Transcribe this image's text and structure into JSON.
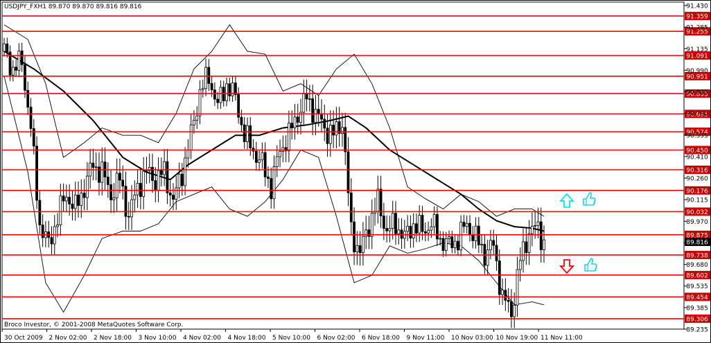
{
  "chart_data": {
    "type": "candlestick",
    "title": "USDJPY_FXH1 89.870 89.870 89.816 89.816",
    "watermark": "Broco Investor, © 2001-2008 MetaQuotes Software Corp.",
    "current_price": "89.816",
    "y_range": [
      89.235,
      91.43
    ],
    "y_ticks": [
      "91.430",
      "91.285",
      "91.135",
      "90.990",
      "90.845",
      "90.700",
      "90.555",
      "90.410",
      "90.260",
      "90.115",
      "89.970",
      "89.825",
      "89.680",
      "89.535",
      "89.385",
      "89.235"
    ],
    "x_ticks": [
      "30 Oct 2009",
      "2 Nov 02:00",
      "2 Nov 18:00",
      "3 Nov 10:00",
      "4 Nov 02:00",
      "4 Nov 18:00",
      "5 Nov 10:00",
      "6 Nov 02:00",
      "6 Nov 18:00",
      "9 Nov 11:00",
      "10 Nov 03:00",
      "10 Nov 19:00",
      "11 Nov 11:00"
    ],
    "levels": [
      "91.359",
      "91.255",
      "91.091",
      "90.951",
      "90.833",
      "90.695",
      "90.574",
      "90.450",
      "90.316",
      "90.176",
      "90.032",
      "89.875",
      "89.738",
      "89.602",
      "89.454",
      "89.306"
    ],
    "grid": false,
    "colors": {
      "level": "#ff0000",
      "level_label_bg": "#cc0000",
      "candle": "#000000",
      "current_bg": "#000000",
      "arrow_up": "#00e5ff",
      "arrow_down": "#ff0000",
      "icon": "#00c8e0"
    },
    "icons": [
      "arrow-up-icon",
      "thumbs-up-icon",
      "arrow-down-icon",
      "thumbs-up-icon"
    ],
    "close_path": [
      [
        0,
        91.12
      ],
      [
        3,
        91.0
      ],
      [
        6,
        91.05
      ],
      [
        9,
        90.6
      ],
      [
        12,
        89.95
      ],
      [
        15,
        89.8
      ],
      [
        18,
        90.0
      ],
      [
        21,
        90.15
      ],
      [
        24,
        90.05
      ],
      [
        27,
        90.2
      ],
      [
        30,
        90.35
      ],
      [
        33,
        90.3
      ],
      [
        36,
        90.15
      ],
      [
        39,
        90.25
      ],
      [
        42,
        90.0
      ],
      [
        45,
        90.2
      ],
      [
        48,
        90.3
      ],
      [
        51,
        90.25
      ],
      [
        54,
        90.3
      ],
      [
        57,
        90.1
      ],
      [
        60,
        90.3
      ],
      [
        63,
        90.55
      ],
      [
        66,
        90.85
      ],
      [
        69,
        90.95
      ],
      [
        72,
        90.75
      ],
      [
        75,
        90.9
      ],
      [
        78,
        90.8
      ],
      [
        81,
        90.55
      ],
      [
        84,
        90.45
      ],
      [
        87,
        90.35
      ],
      [
        90,
        90.2
      ],
      [
        93,
        90.45
      ],
      [
        96,
        90.55
      ],
      [
        99,
        90.7
      ],
      [
        102,
        90.8
      ],
      [
        105,
        90.7
      ],
      [
        108,
        90.6
      ],
      [
        111,
        90.55
      ],
      [
        114,
        90.65
      ],
      [
        117,
        89.9
      ],
      [
        120,
        89.75
      ],
      [
        123,
        89.95
      ],
      [
        126,
        90.1
      ],
      [
        129,
        89.9
      ],
      [
        132,
        89.95
      ],
      [
        135,
        89.85
      ],
      [
        138,
        89.95
      ],
      [
        141,
        89.9
      ],
      [
        144,
        89.95
      ],
      [
        147,
        89.85
      ],
      [
        150,
        89.8
      ],
      [
        153,
        89.85
      ],
      [
        156,
        89.95
      ],
      [
        159,
        89.85
      ],
      [
        162,
        89.75
      ],
      [
        165,
        89.8
      ],
      [
        168,
        89.45
      ],
      [
        171,
        89.35
      ],
      [
        174,
        89.7
      ],
      [
        177,
        89.9
      ],
      [
        180,
        89.92
      ],
      [
        182,
        89.82
      ]
    ],
    "band_upper": [
      [
        0,
        91.3
      ],
      [
        8,
        91.2
      ],
      [
        14,
        90.9
      ],
      [
        20,
        90.4
      ],
      [
        27,
        90.5
      ],
      [
        33,
        90.6
      ],
      [
        40,
        90.55
      ],
      [
        46,
        90.55
      ],
      [
        52,
        90.5
      ],
      [
        58,
        90.7
      ],
      [
        64,
        91.0
      ],
      [
        70,
        91.12
      ],
      [
        76,
        91.3
      ],
      [
        82,
        91.12
      ],
      [
        88,
        91.1
      ],
      [
        94,
        90.85
      ],
      [
        100,
        90.9
      ],
      [
        106,
        90.82
      ],
      [
        112,
        91.0
      ],
      [
        118,
        91.1
      ],
      [
        124,
        90.9
      ],
      [
        130,
        90.6
      ],
      [
        136,
        90.2
      ],
      [
        142,
        90.12
      ],
      [
        148,
        90.05
      ],
      [
        154,
        90.15
      ],
      [
        160,
        90.1
      ],
      [
        166,
        90.0
      ],
      [
        172,
        90.05
      ],
      [
        178,
        90.05
      ],
      [
        182,
        90.0
      ]
    ],
    "band_lower": [
      [
        0,
        90.95
      ],
      [
        8,
        90.3
      ],
      [
        14,
        89.55
      ],
      [
        20,
        89.35
      ],
      [
        27,
        89.6
      ],
      [
        33,
        89.85
      ],
      [
        40,
        89.9
      ],
      [
        46,
        89.9
      ],
      [
        52,
        89.95
      ],
      [
        58,
        90.1
      ],
      [
        64,
        90.15
      ],
      [
        70,
        90.2
      ],
      [
        76,
        90.05
      ],
      [
        82,
        90.0
      ],
      [
        88,
        90.1
      ],
      [
        94,
        90.25
      ],
      [
        100,
        90.45
      ],
      [
        106,
        90.4
      ],
      [
        112,
        90.0
      ],
      [
        118,
        89.55
      ],
      [
        124,
        89.6
      ],
      [
        130,
        89.8
      ],
      [
        136,
        89.75
      ],
      [
        142,
        89.78
      ],
      [
        148,
        89.82
      ],
      [
        154,
        89.8
      ],
      [
        160,
        89.7
      ],
      [
        166,
        89.55
      ],
      [
        172,
        89.4
      ],
      [
        178,
        89.42
      ],
      [
        182,
        89.4
      ]
    ],
    "ma_line": [
      [
        0,
        91.12
      ],
      [
        10,
        91.0
      ],
      [
        20,
        90.85
      ],
      [
        30,
        90.65
      ],
      [
        40,
        90.4
      ],
      [
        48,
        90.3
      ],
      [
        56,
        90.25
      ],
      [
        62,
        90.35
      ],
      [
        70,
        90.45
      ],
      [
        78,
        90.55
      ],
      [
        86,
        90.55
      ],
      [
        94,
        90.6
      ],
      [
        102,
        90.62
      ],
      [
        110,
        90.65
      ],
      [
        116,
        90.68
      ],
      [
        122,
        90.6
      ],
      [
        130,
        90.45
      ],
      [
        138,
        90.35
      ],
      [
        146,
        90.25
      ],
      [
        154,
        90.15
      ],
      [
        160,
        90.05
      ],
      [
        166,
        89.97
      ],
      [
        172,
        89.93
      ],
      [
        178,
        89.92
      ],
      [
        182,
        89.9
      ]
    ]
  }
}
